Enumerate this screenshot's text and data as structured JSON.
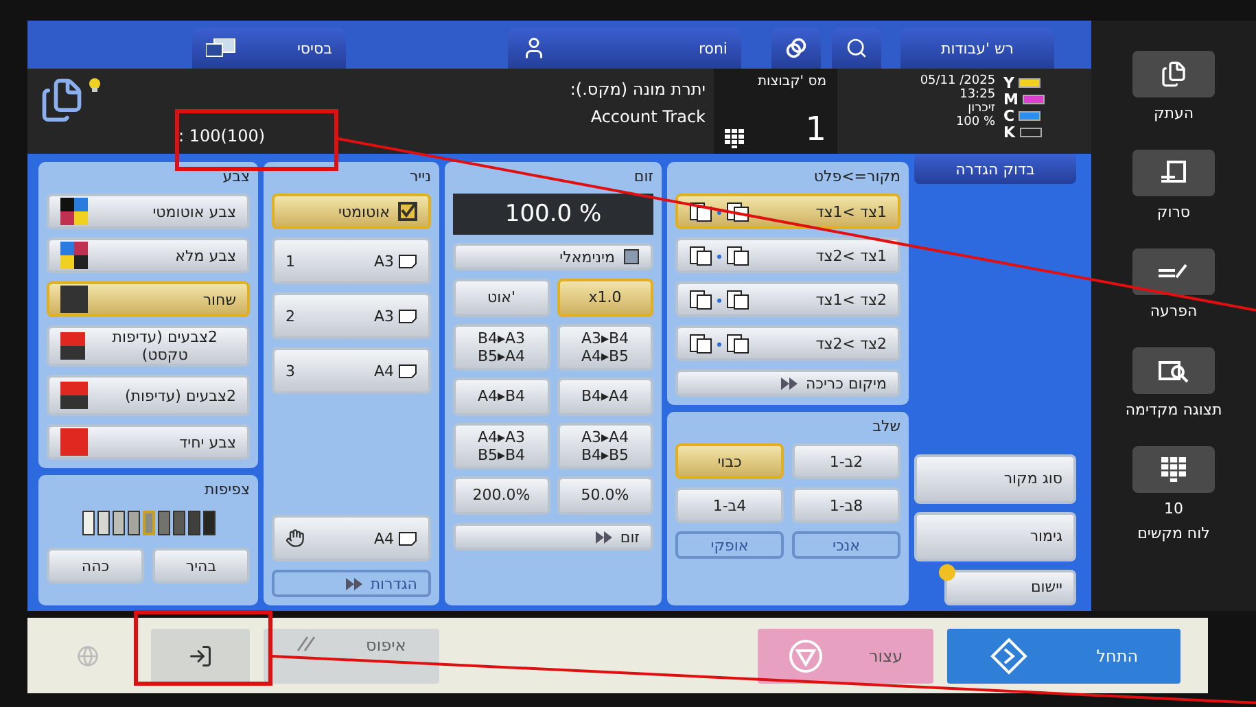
{
  "top_bar": {
    "mode_tab": "בסיסי",
    "user": "roni",
    "job_list": "רש 'עבודות"
  },
  "info": {
    "counter": ": 100(100)",
    "account_label": "יתרת מונה (מקס.):",
    "account_value": "Account Track",
    "copies_label": "מס 'קבוצות",
    "copies": "1",
    "date": "05/11 /2025",
    "time": "13:25",
    "memory_label": "זיכרון",
    "memory": "100 %",
    "toners": [
      {
        "letter": "Y",
        "color": "#f0d020",
        "level": 1
      },
      {
        "letter": "M",
        "color": "#e040d0",
        "level": 1
      },
      {
        "letter": "C",
        "color": "#2a8ff0",
        "level": 1
      },
      {
        "letter": "K",
        "color": "#202020",
        "level": 0
      }
    ]
  },
  "color_panel": {
    "title": "צבע",
    "options": [
      {
        "label": "צבע אוטומטי",
        "kind": "auto",
        "selected": false
      },
      {
        "label": "צבע מלא",
        "kind": "full",
        "selected": false
      },
      {
        "label": "שחור",
        "kind": "black",
        "selected": true
      },
      {
        "label": "2צבעים (עדיפות טקסט)",
        "kind": "two",
        "selected": false
      },
      {
        "label": "2צבעים (עדיפות)",
        "kind": "two",
        "selected": false
      },
      {
        "label": "צבע יחיד",
        "kind": "single",
        "selected": false
      }
    ]
  },
  "density_panel": {
    "title": "צפיפות",
    "level": 0.5,
    "buttons": [
      "בהיר",
      "כהה"
    ]
  },
  "paper_panel": {
    "title": "נייר",
    "auto": {
      "label": "אוטומטי",
      "selected": true
    },
    "trays": [
      {
        "number": "1",
        "size": "A3",
        "kind": "tray",
        "selected": false
      },
      {
        "number": "2",
        "size": "A3",
        "kind": "tray",
        "selected": false
      },
      {
        "number": "3",
        "size": "A4",
        "kind": "tray",
        "selected": false
      },
      {
        "size": "A4",
        "kind": "bypass",
        "selected": false
      }
    ],
    "settings": "הגדרות"
  },
  "zoom_panel": {
    "title": "זום",
    "value": "100.0 %",
    "minimal": {
      "label": "מינימאלי",
      "checked": false
    },
    "buttons": [
      {
        "label": "x1.0",
        "selected": true
      },
      {
        "label": "אוט'",
        "selected": false
      },
      {
        "label": "A3▸B4\nA4▸B5",
        "selected": false
      },
      {
        "label": "B4▸A3\nB5▸A4",
        "selected": false
      },
      {
        "label": "B4▸A4",
        "selected": false
      },
      {
        "label": "A4▸B4",
        "selected": false
      },
      {
        "label": "A3▸A4\nB4▸B5",
        "selected": false
      },
      {
        "label": "A4▸A3\nB5▸B4",
        "selected": false
      },
      {
        "label": "50.0%",
        "selected": false
      },
      {
        "label": "200.0%",
        "selected": false
      }
    ],
    "more": "זום"
  },
  "duplex_panel": {
    "title": "מקור=>פלט",
    "options": [
      {
        "label": "1צד >1צד",
        "selected": true
      },
      {
        "label": "1צד >2צד",
        "selected": false
      },
      {
        "label": "2צד >1צד",
        "selected": false
      },
      {
        "label": "2צד >2צד",
        "selected": false
      }
    ],
    "binding": "מיקום כריכה"
  },
  "combine_panel": {
    "title": "שלב",
    "options": [
      {
        "label": "2ב-1",
        "selected": false
      },
      {
        "label": "כבוי",
        "selected": true
      },
      {
        "label": "8ב-1",
        "selected": false
      },
      {
        "label": "4ב-1",
        "selected": false
      }
    ],
    "orientation": [
      {
        "label": "אנכי",
        "disabled": true
      },
      {
        "label": "אופקי",
        "disabled": true
      }
    ]
  },
  "right_column": {
    "check": "בדוק הגדרה",
    "buttons": [
      "סוג מקור",
      "גימור",
      "יישום"
    ]
  },
  "sidebar": [
    {
      "label": "העתק",
      "kind": "copy"
    },
    {
      "label": "סרוק",
      "kind": "scan"
    },
    {
      "label": "הפרעה",
      "kind": "interrupt"
    },
    {
      "label": "תצוגה מקדימה",
      "kind": "preview"
    },
    {
      "label": "לוח מקשים",
      "kind": "keypad",
      "count": "10"
    }
  ],
  "bottom_bar": {
    "reset": {
      "label": "איפוס",
      "disabled": true
    },
    "stop": "עצור",
    "start": "התחל"
  }
}
